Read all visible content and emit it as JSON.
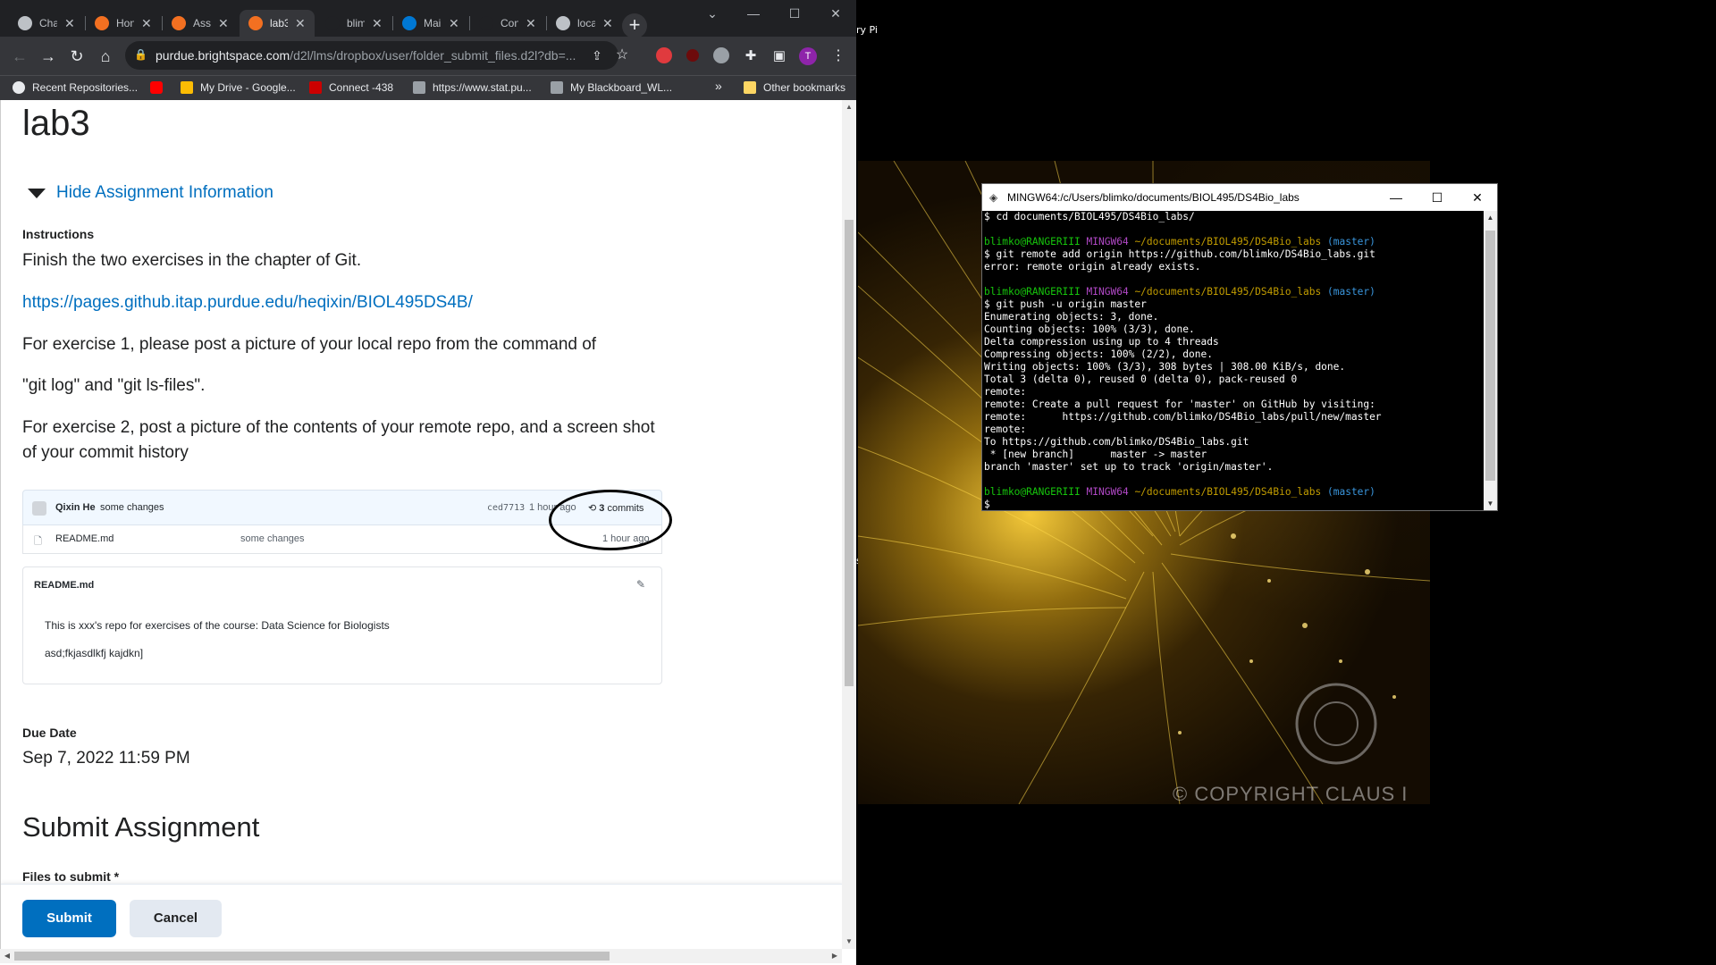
{
  "browser": {
    "tabs": [
      {
        "title": "Cha",
        "favicon_color": "#bdc1c6",
        "icon": "chrome-icon"
      },
      {
        "title": "Hon",
        "favicon_color": "#f37021",
        "icon": "brightspace-icon"
      },
      {
        "title": "Assi",
        "favicon_color": "#f37021",
        "icon": "brightspace-icon"
      },
      {
        "title": "lab3",
        "favicon_color": "#f37021",
        "icon": "brightspace-icon",
        "active": true
      },
      {
        "title": "blim",
        "favicon_color": "#202124",
        "icon": "github-icon"
      },
      {
        "title": "Mai",
        "favicon_color": "#0078d4",
        "icon": "outlook-icon"
      },
      {
        "title": "Con",
        "favicon_color": "#202124",
        "icon": "github-icon"
      },
      {
        "title": "loca",
        "favicon_color": "#bdc1c6",
        "icon": "globe-icon"
      }
    ],
    "tab_close": "✕",
    "new_tab": "+",
    "url_domain": "purdue.brightspace.com",
    "url_rest": "/d2l/lms/dropbox/user/folder_submit_files.d2l?db=...",
    "profile_initial": "T",
    "bookmarks": [
      {
        "label": "Recent Repositories...",
        "icon": "github-icon",
        "color": "#e8eaed"
      },
      {
        "label": "",
        "icon": "youtube-icon",
        "color": "#ff0000"
      },
      {
        "label": "My Drive - Google...",
        "icon": "drive-icon",
        "color": "#fbbc04"
      },
      {
        "label": "Connect -438",
        "icon": "connect-icon",
        "color": "#cc0000"
      },
      {
        "label": "https://www.stat.pu...",
        "icon": "stat-icon",
        "color": "#9aa0a6"
      },
      {
        "label": "My Blackboard_WL...",
        "icon": "blackboard-icon",
        "color": "#9aa0a6"
      }
    ],
    "bookmarks_overflow": "»",
    "other_bookmarks": "Other bookmarks"
  },
  "page": {
    "title": "lab3",
    "hide_info": "Hide Assignment Information",
    "instructions_label": "Instructions",
    "instruction_lines": [
      "Finish the two exercises in the chapter of Git.",
      "https://pages.github.itap.purdue.edu/heqixin/BIOL495DS4B/",
      "For exercise 1, please post a picture of your local repo from the command of",
      "\"git log\" and \"git ls-files\".",
      "For exercise 2, post a picture of the contents of your remote repo, and a screen shot of your commit history"
    ],
    "github": {
      "author": "Qixin He",
      "commit_msg": "some changes",
      "sha": "ced7713",
      "time": "1 hour ago",
      "commits_count": "3",
      "commits_label": "commits",
      "file_name": "README.md",
      "file_msg": "some changes",
      "file_time": "1 hour ago",
      "readme_title": "README.md",
      "readme_line1": "This is xxx's repo for exercises of the course: Data Science for Biologists",
      "readme_line2": "asd;fkjasdlkfj kajdkn]"
    },
    "due_label": "Due Date",
    "due_value": "Sep 7, 2022 11:59 PM",
    "submit_heading": "Submit Assignment",
    "files_label": "Files to submit *",
    "submit_button": "Submit",
    "cancel_button": "Cancel"
  },
  "terminal": {
    "title": "MINGW64:/c/Users/blimko/documents/BIOL495/DS4Bio_labs",
    "prompt_user": "blimko@RANGERIII",
    "prompt_env": "MINGW64",
    "prompt_path": "~/documents/BIOL495/DS4Bio_labs",
    "prompt_branch": "(master)",
    "line_cd": "$ cd documents/BIOL495/DS4Bio_labs/",
    "line_remote": "$ git remote add origin https://github.com/blimko/DS4Bio_labs.git",
    "line_error": "error: remote origin already exists.",
    "line_push": "$ git push -u origin master",
    "push_output": [
      "Enumerating objects: 3, done.",
      "Counting objects: 100% (3/3), done.",
      "Delta compression using up to 4 threads",
      "Compressing objects: 100% (2/2), done.",
      "Writing objects: 100% (3/3), 308 bytes | 308.00 KiB/s, done.",
      "Total 3 (delta 0), reused 0 (delta 0), pack-reused 0",
      "remote:",
      "remote: Create a pull request for 'master' on GitHub by visiting:",
      "remote:      https://github.com/blimko/DS4Bio_labs/pull/new/master",
      "remote:",
      "To https://github.com/blimko/DS4Bio_labs.git",
      " * [new branch]      master -> master",
      "branch 'master' set up to track 'origin/master'."
    ],
    "final_prompt": "$"
  },
  "desktop": {
    "frag_top": "ry Pi",
    "frag_mid": "st",
    "wallpaper_text": "© COPYRIGHT CLAUS I"
  }
}
